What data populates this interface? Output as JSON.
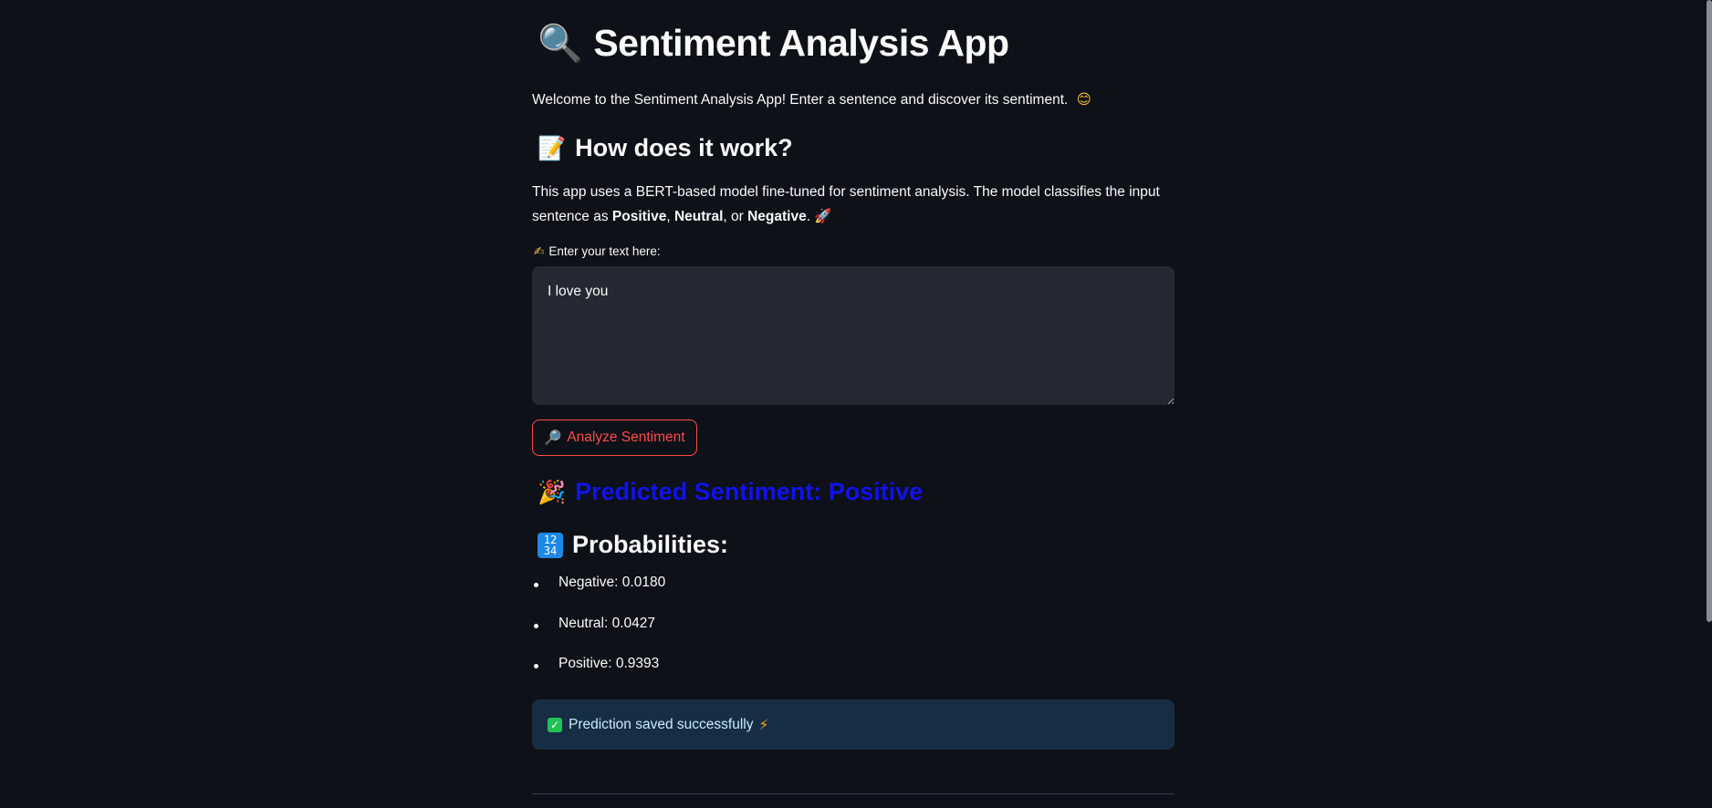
{
  "app": {
    "title": "Sentiment Analysis App",
    "title_icon": "🔍",
    "welcome_text": "Welcome to the Sentiment Analysis App! Enter a sentence and discover its sentiment.",
    "welcome_icon": "😊"
  },
  "how_it_works": {
    "heading": "How does it work?",
    "heading_icon": "📝",
    "desc_prefix": "This app uses a BERT-based model fine-tuned for sentiment analysis. The model classifies the input sentence as ",
    "label_positive": "Positive",
    "sep1": ", ",
    "label_neutral": "Neutral",
    "sep2": ", or ",
    "label_negative": "Negative",
    "desc_suffix": ".",
    "desc_icon": "🚀"
  },
  "input": {
    "label": "Enter your text here:",
    "label_icon": "✍",
    "value": "I love you"
  },
  "button": {
    "label": "Analyze Sentiment",
    "icon": "🔎"
  },
  "result": {
    "predicted_text": "Predicted Sentiment: Positive",
    "predicted_icon": "🎉",
    "predicted_color": "#1111ee",
    "probabilities_heading": "Probabilities:",
    "probabilities_icon": "1234",
    "probabilities": [
      {
        "label": "Negative: 0.0180"
      },
      {
        "label": "Neutral: 0.0427"
      },
      {
        "label": "Positive: 0.9393"
      }
    ]
  },
  "alert": {
    "text": "Prediction saved successfully",
    "icon_check": "✓",
    "icon_bolt": "⚡"
  },
  "colors": {
    "background": "#0e1117",
    "button_accent": "#ff4b4b",
    "alert_bg": "#172d43",
    "input_bg": "#262730"
  }
}
